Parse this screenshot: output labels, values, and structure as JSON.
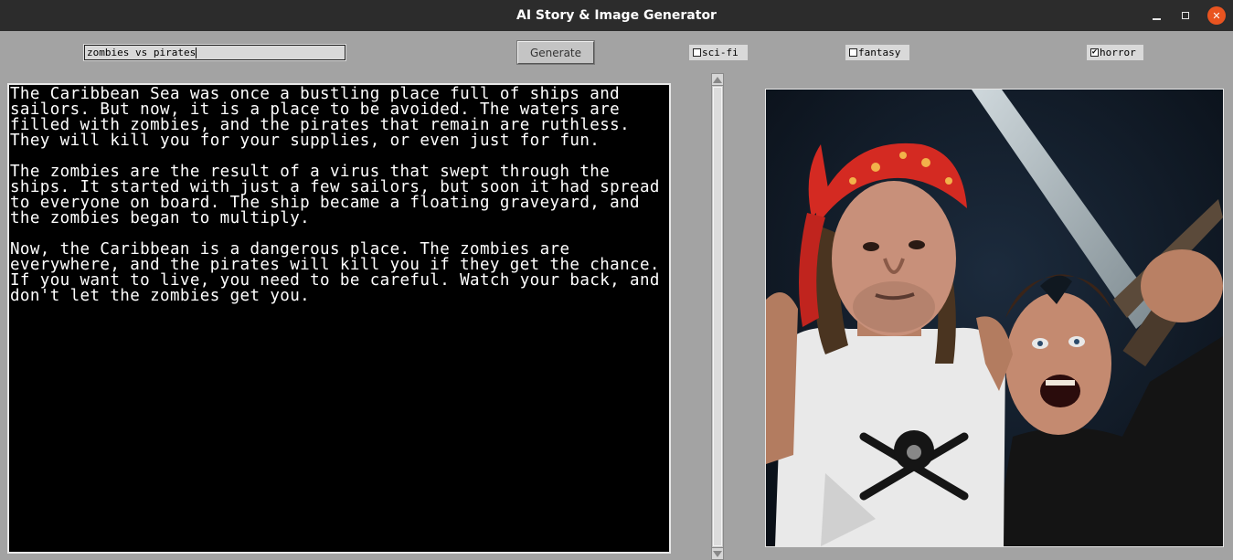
{
  "window": {
    "title": "AI Story & Image Generator",
    "minimize_icon": "minimize-icon",
    "maximize_icon": "maximize-icon",
    "close_icon": "close-icon",
    "close_color": "#e95420"
  },
  "controls": {
    "prompt_value": "zombies vs pirates",
    "generate_label": "Generate",
    "genres": [
      {
        "label": "sci-fi",
        "checked": false
      },
      {
        "label": "fantasy",
        "checked": false
      },
      {
        "label": "horror",
        "checked": true
      }
    ]
  },
  "story": {
    "paragraphs": [
      "The Caribbean Sea was once a bustling place full of ships and sailors. But now, it is a place to be avoided. The waters are filled with zombies, and the pirates that remain are ruthless. They will kill you for your supplies, or even just for fun.",
      "The zombies are the result of a virus that swept through the ships. It started with just a few sailors, but soon it had spread to everyone on board. The ship became a floating graveyard, and the zombies began to multiply.",
      "Now, the Caribbean is a dangerous place. The zombies are everywhere, and the pirates will kill you if they get the chance. If you want to live, you need to be careful. Watch your back, and don't let the zombies get you."
    ]
  },
  "image": {
    "description_icon": "generated-image",
    "colors": {
      "background": "#0f1a27",
      "bandana": "#d42a22",
      "shirt": "#ececec",
      "skin": "#c98f73"
    }
  }
}
